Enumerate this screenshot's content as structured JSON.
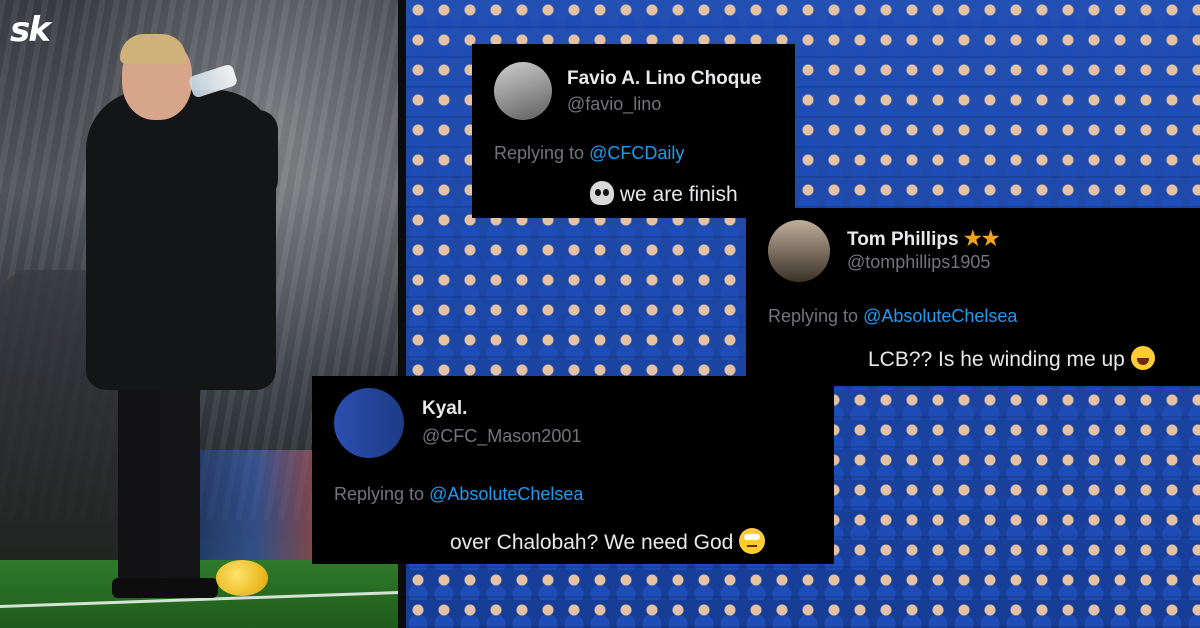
{
  "brand": {
    "logo_text": "sk"
  },
  "tweets": [
    {
      "name": "Favio A. Lino Choque",
      "handle": "@favio_lino",
      "replying_prefix": "Replying to",
      "replying_to": "@CFCDaily",
      "text": "we are finish",
      "emoji": "skull"
    },
    {
      "name": "Tom Phillips",
      "badges": "★★",
      "handle": "@tomphillips1905",
      "replying_prefix": "Replying to",
      "replying_to": "@AbsoluteChelsea",
      "text": "LCB?? Is he winding me up",
      "emoji": "face-with-tears-of-joy"
    },
    {
      "name": "Kyal.",
      "handle": "@CFC_Mason2001",
      "replying_prefix": "Replying to",
      "replying_to": "@AbsoluteChelsea",
      "text": "over Chalobah? We need God",
      "emoji": "face-with-rolling-eyes"
    }
  ],
  "colors": {
    "mention": "#1d9bf0",
    "card_bg": "#000000",
    "star": "#f2a21b"
  }
}
